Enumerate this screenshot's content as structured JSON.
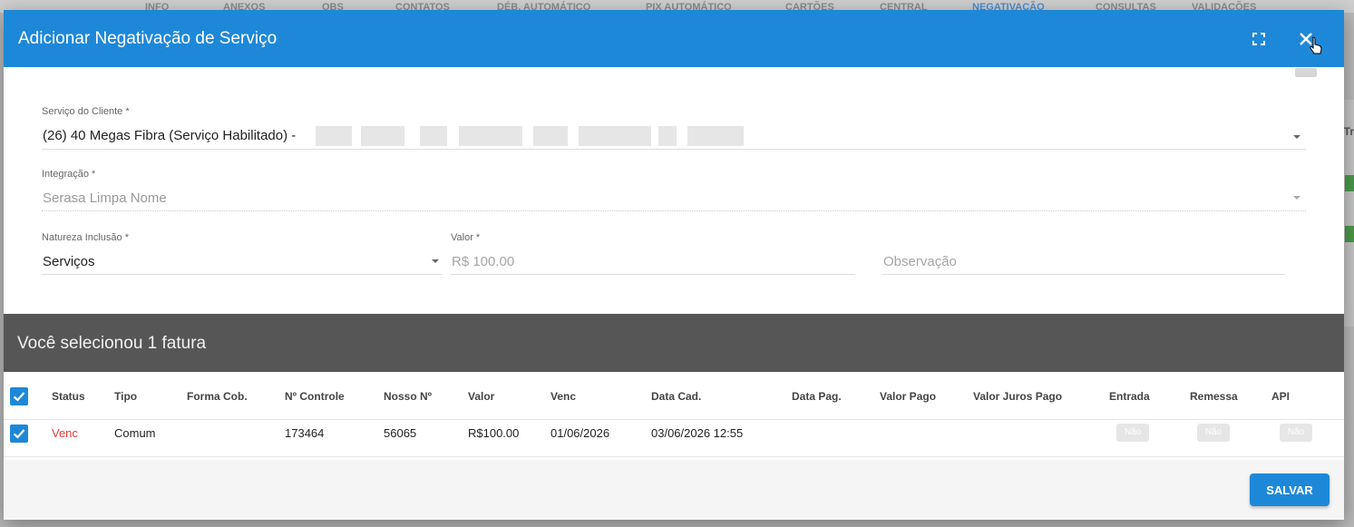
{
  "background": {
    "tabs": [
      "INFO",
      "ANEXOS",
      "OBS",
      "CONTATOS",
      "DÉB. AUTOMÁTICO",
      "PIX AUTOMÁTICO",
      "CARTÕES",
      "CENTRAL",
      "NEGATIVAÇÃO",
      "CONSULTAS",
      "VALIDAÇÕES"
    ],
    "active_tab": "NEGATIVAÇÃO",
    "side_text": "Tr"
  },
  "modal": {
    "title": "Adicionar Negativação de Serviço",
    "icons": {
      "fullscreen": "fullscreen-icon",
      "close": "close-icon"
    }
  },
  "form": {
    "servico": {
      "label": "Serviço do Cliente *",
      "value": "(26) 40 Megas Fibra (Serviço Habilitado) -"
    },
    "integracao": {
      "label": "Integração *",
      "value": "Serasa Limpa Nome"
    },
    "natureza": {
      "label": "Natureza Inclusão *",
      "value": "Serviços"
    },
    "valor": {
      "label": "Valor *",
      "value": "R$ 100.00"
    },
    "observacao": {
      "placeholder": "Observação"
    }
  },
  "selection": {
    "text": "Você selecionou 1 fatura"
  },
  "table": {
    "headers": [
      "Status",
      "Tipo",
      "Forma Cob.",
      "Nº Controle",
      "Nosso Nº",
      "Valor",
      "Venc",
      "Data Cad.",
      "Data Pag.",
      "Valor Pago",
      "Valor Juros Pago",
      "Entrada",
      "Remessa",
      "API"
    ],
    "rows": [
      {
        "status": "Venc",
        "tipo": "Comum",
        "forma_cob": "",
        "controle": "173464",
        "nosso": "56065",
        "valor": "R$100.00",
        "venc": "01/06/2026",
        "data_cad": "03/06/2026 12:55",
        "data_pag": "",
        "valor_pago": "",
        "juros": "",
        "entrada": "Não",
        "remessa": "Não",
        "api": "Não"
      }
    ]
  },
  "footer": {
    "save_label": "SALVAR"
  },
  "colors": {
    "primary": "#1e88d8",
    "dark_bar": "#565656",
    "status_red": "#e53935"
  }
}
